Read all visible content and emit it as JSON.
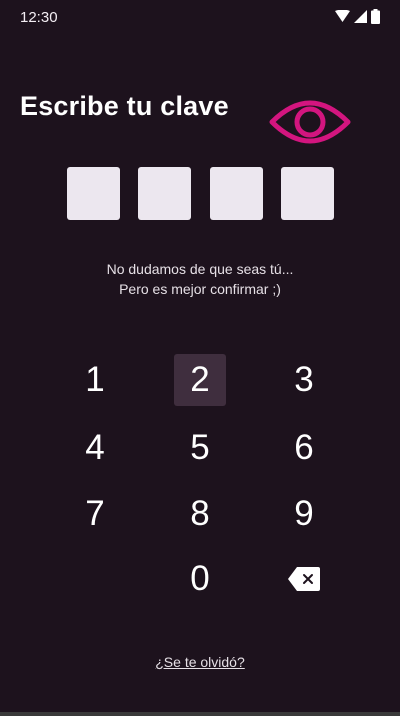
{
  "status_bar": {
    "time": "12:30",
    "icons": [
      "wifi-icon",
      "cell-signal-icon",
      "battery-icon"
    ]
  },
  "header": {
    "title": "Escribe tu clave",
    "visibility_icon": "eye-icon"
  },
  "pin": {
    "length": 4,
    "entered": 0
  },
  "message": {
    "line1": "No dudamos de que seas tú...",
    "line2": "Pero es mejor confirmar ;)"
  },
  "keypad": {
    "keys": [
      "1",
      "2",
      "3",
      "4",
      "5",
      "6",
      "7",
      "8",
      "9",
      "0"
    ],
    "active_key": "2",
    "backspace_icon": "backspace-icon"
  },
  "footer": {
    "forgot_link": "¿Se te olvidó?"
  },
  "colors": {
    "background": "#1d121d",
    "accent": "#d3157f",
    "pin_box": "#ece7ef",
    "key_pressed": "#3f2e3e"
  }
}
